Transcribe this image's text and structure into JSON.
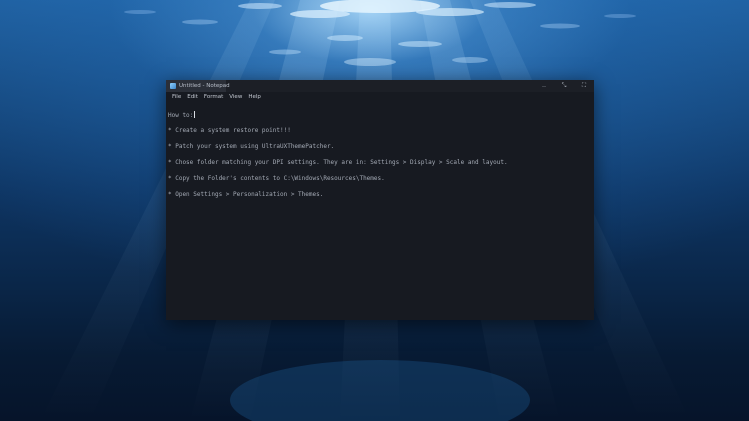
{
  "window": {
    "title": "Untitled - Notepad",
    "app_icon": "notepad-icon",
    "controls": {
      "minimize": "‥",
      "maximize": "⤡",
      "fullscreen": "⛶"
    }
  },
  "menu": {
    "items": [
      "File",
      "Edit",
      "Format",
      "View",
      "Help"
    ]
  },
  "editor": {
    "lines": [
      "How to:",
      "* Create a system restore point!!!",
      "* Patch your system using UltraUXThemePatcher.",
      "* Chose folder matching your DPI settings. They are in: Settings > Display > Scale and layout.",
      "* Copy the Folder's contents to C:\\Windows\\Resources\\Themes.",
      "* Open Settings > Personalization > Themes."
    ]
  },
  "colors": {
    "editor_background": "#171a21",
    "text": "#a3a9b4",
    "tab_background": "#2b2f38"
  }
}
